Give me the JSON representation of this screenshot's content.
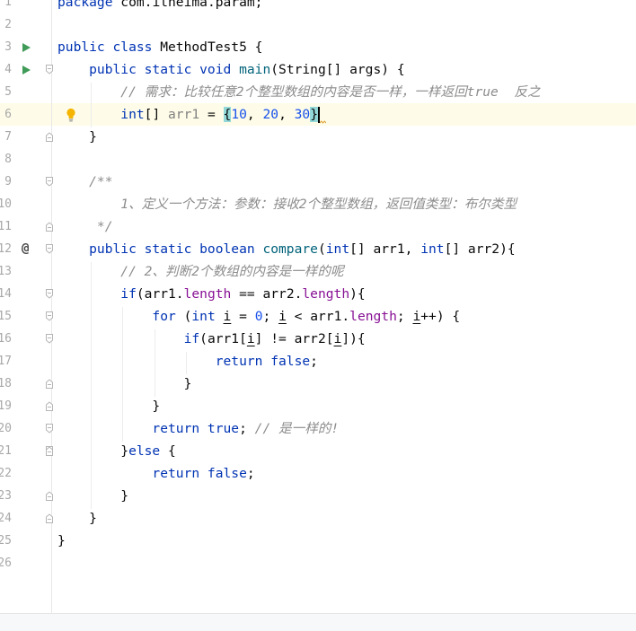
{
  "editor": {
    "line_numbers": [
      "1",
      "2",
      "3",
      "4",
      "5",
      "6",
      "7",
      "8",
      "9",
      "10",
      "11",
      "12",
      "13",
      "14",
      "15",
      "16",
      "17",
      "18",
      "19",
      "20",
      "21",
      "22",
      "23",
      "24",
      "25",
      "26"
    ],
    "current_line": 6,
    "lines": [
      [
        {
          "t": "package",
          "c": "kw"
        },
        {
          "t": " com.itheima.param;",
          "c": "id"
        }
      ],
      [],
      [
        {
          "t": "public class",
          "c": "kw"
        },
        {
          "t": " MethodTest5 {",
          "c": "id"
        }
      ],
      [
        {
          "t": "    public static void",
          "c": "kw"
        },
        {
          "t": " ",
          "c": "id"
        },
        {
          "t": "main",
          "c": "fn"
        },
        {
          "t": "(String[] args) {",
          "c": "id"
        }
      ],
      [
        {
          "t": "        // 需求：比较任意2个整型数组的内容是否一样，一样返回true  反之",
          "c": "cmt"
        }
      ],
      [
        {
          "t": "        int",
          "c": "kw"
        },
        {
          "t": "[] ",
          "c": "id"
        },
        {
          "t": "arr1",
          "c": "unused"
        },
        {
          "t": " = ",
          "c": "id"
        },
        {
          "t": "{",
          "c": "brace"
        },
        {
          "t": "10",
          "c": "num"
        },
        {
          "t": ", ",
          "c": "id"
        },
        {
          "t": "20",
          "c": "num"
        },
        {
          "t": ", ",
          "c": "id"
        },
        {
          "t": "30",
          "c": "num"
        },
        {
          "t": "}",
          "c": "brace"
        },
        {
          "t": "",
          "c": "caret"
        }
      ],
      [
        {
          "t": "    }",
          "c": "id"
        }
      ],
      [],
      [
        {
          "t": "    /**",
          "c": "doc"
        }
      ],
      [
        {
          "t": "        1、定义一个方法：参数：接收2个整型数组，返回值类型：布尔类型",
          "c": "doc"
        }
      ],
      [
        {
          "t": "     */",
          "c": "doc"
        }
      ],
      [
        {
          "t": "    public static boolean",
          "c": "kw"
        },
        {
          "t": " ",
          "c": "id"
        },
        {
          "t": "compare",
          "c": "fnc"
        },
        {
          "t": "(",
          "c": "id"
        },
        {
          "t": "int",
          "c": "kw"
        },
        {
          "t": "[] arr1, ",
          "c": "id"
        },
        {
          "t": "int",
          "c": "kw"
        },
        {
          "t": "[] arr2){",
          "c": "id"
        }
      ],
      [
        {
          "t": "        // 2、判断2个数组的内容是一样的呢",
          "c": "cmt"
        }
      ],
      [
        {
          "t": "        if",
          "c": "kw"
        },
        {
          "t": "(arr1.",
          "c": "id"
        },
        {
          "t": "length",
          "c": "field"
        },
        {
          "t": " == arr2.",
          "c": "id"
        },
        {
          "t": "length",
          "c": "field"
        },
        {
          "t": "){",
          "c": "id"
        }
      ],
      [
        {
          "t": "            for",
          "c": "kw"
        },
        {
          "t": " (",
          "c": "id"
        },
        {
          "t": "int",
          "c": "kw"
        },
        {
          "t": " ",
          "c": "id"
        },
        {
          "t": "i",
          "c": "loopvar"
        },
        {
          "t": " = ",
          "c": "id"
        },
        {
          "t": "0",
          "c": "num"
        },
        {
          "t": "; ",
          "c": "id"
        },
        {
          "t": "i",
          "c": "loopvar"
        },
        {
          "t": " < arr1.",
          "c": "id"
        },
        {
          "t": "length",
          "c": "field"
        },
        {
          "t": "; ",
          "c": "id"
        },
        {
          "t": "i",
          "c": "loopvar"
        },
        {
          "t": "++) {",
          "c": "id"
        }
      ],
      [
        {
          "t": "                if",
          "c": "kw"
        },
        {
          "t": "(arr1[",
          "c": "id"
        },
        {
          "t": "i",
          "c": "loopvar"
        },
        {
          "t": "] != arr2[",
          "c": "id"
        },
        {
          "t": "i",
          "c": "loopvar"
        },
        {
          "t": "]){",
          "c": "id"
        }
      ],
      [
        {
          "t": "                    return false",
          "c": "kw"
        },
        {
          "t": ";",
          "c": "id"
        }
      ],
      [
        {
          "t": "                }",
          "c": "id"
        }
      ],
      [
        {
          "t": "            }",
          "c": "id"
        }
      ],
      [
        {
          "t": "            return true",
          "c": "kw"
        },
        {
          "t": "; ",
          "c": "id"
        },
        {
          "t": "// 是一样的!",
          "c": "cmt"
        }
      ],
      [
        {
          "t": "        }",
          "c": "id"
        },
        {
          "t": "else",
          "c": "kw"
        },
        {
          "t": " {",
          "c": "id"
        }
      ],
      [
        {
          "t": "            return false",
          "c": "kw"
        },
        {
          "t": ";",
          "c": "id"
        }
      ],
      [
        {
          "t": "        }",
          "c": "id"
        }
      ],
      [
        {
          "t": "    }",
          "c": "id"
        }
      ],
      [
        {
          "t": "}",
          "c": "id"
        }
      ],
      []
    ]
  }
}
